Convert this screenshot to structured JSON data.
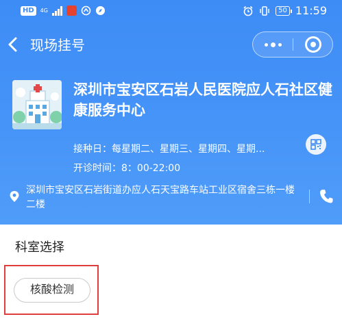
{
  "status_bar": {
    "hd": "HD",
    "network": "4G",
    "time": "11:59",
    "battery": "50",
    "colors": {
      "app_badge": "#e5422f"
    }
  },
  "nav": {
    "title": "现场挂号",
    "icons": {
      "back": "chevron-left-icon",
      "more": "more-dots-icon",
      "close": "miniapp-close-icon"
    }
  },
  "hospital": {
    "name": "深圳市宝安区石岩人民医院应人石社区健康服务中心",
    "vaccination_days": "接种日：每星期二、星期三、星期四、星期...",
    "opening_hours": "开诊时间：8：00-22:00",
    "address": "深圳市宝安区石岩街道办应人石天宝路车站工业区宿舍三栋一楼二楼",
    "icons": {
      "image": "hospital-building-icon",
      "qr": "qr-code-icon",
      "location": "location-pin-icon",
      "phone": "phone-icon"
    }
  },
  "department": {
    "heading": "科室选择",
    "options": [
      "核酸检测"
    ]
  },
  "colors": {
    "header_blue": "#3d8cf6",
    "highlight_red": "#e03c3c",
    "chip_border": "#c9c9c9"
  }
}
